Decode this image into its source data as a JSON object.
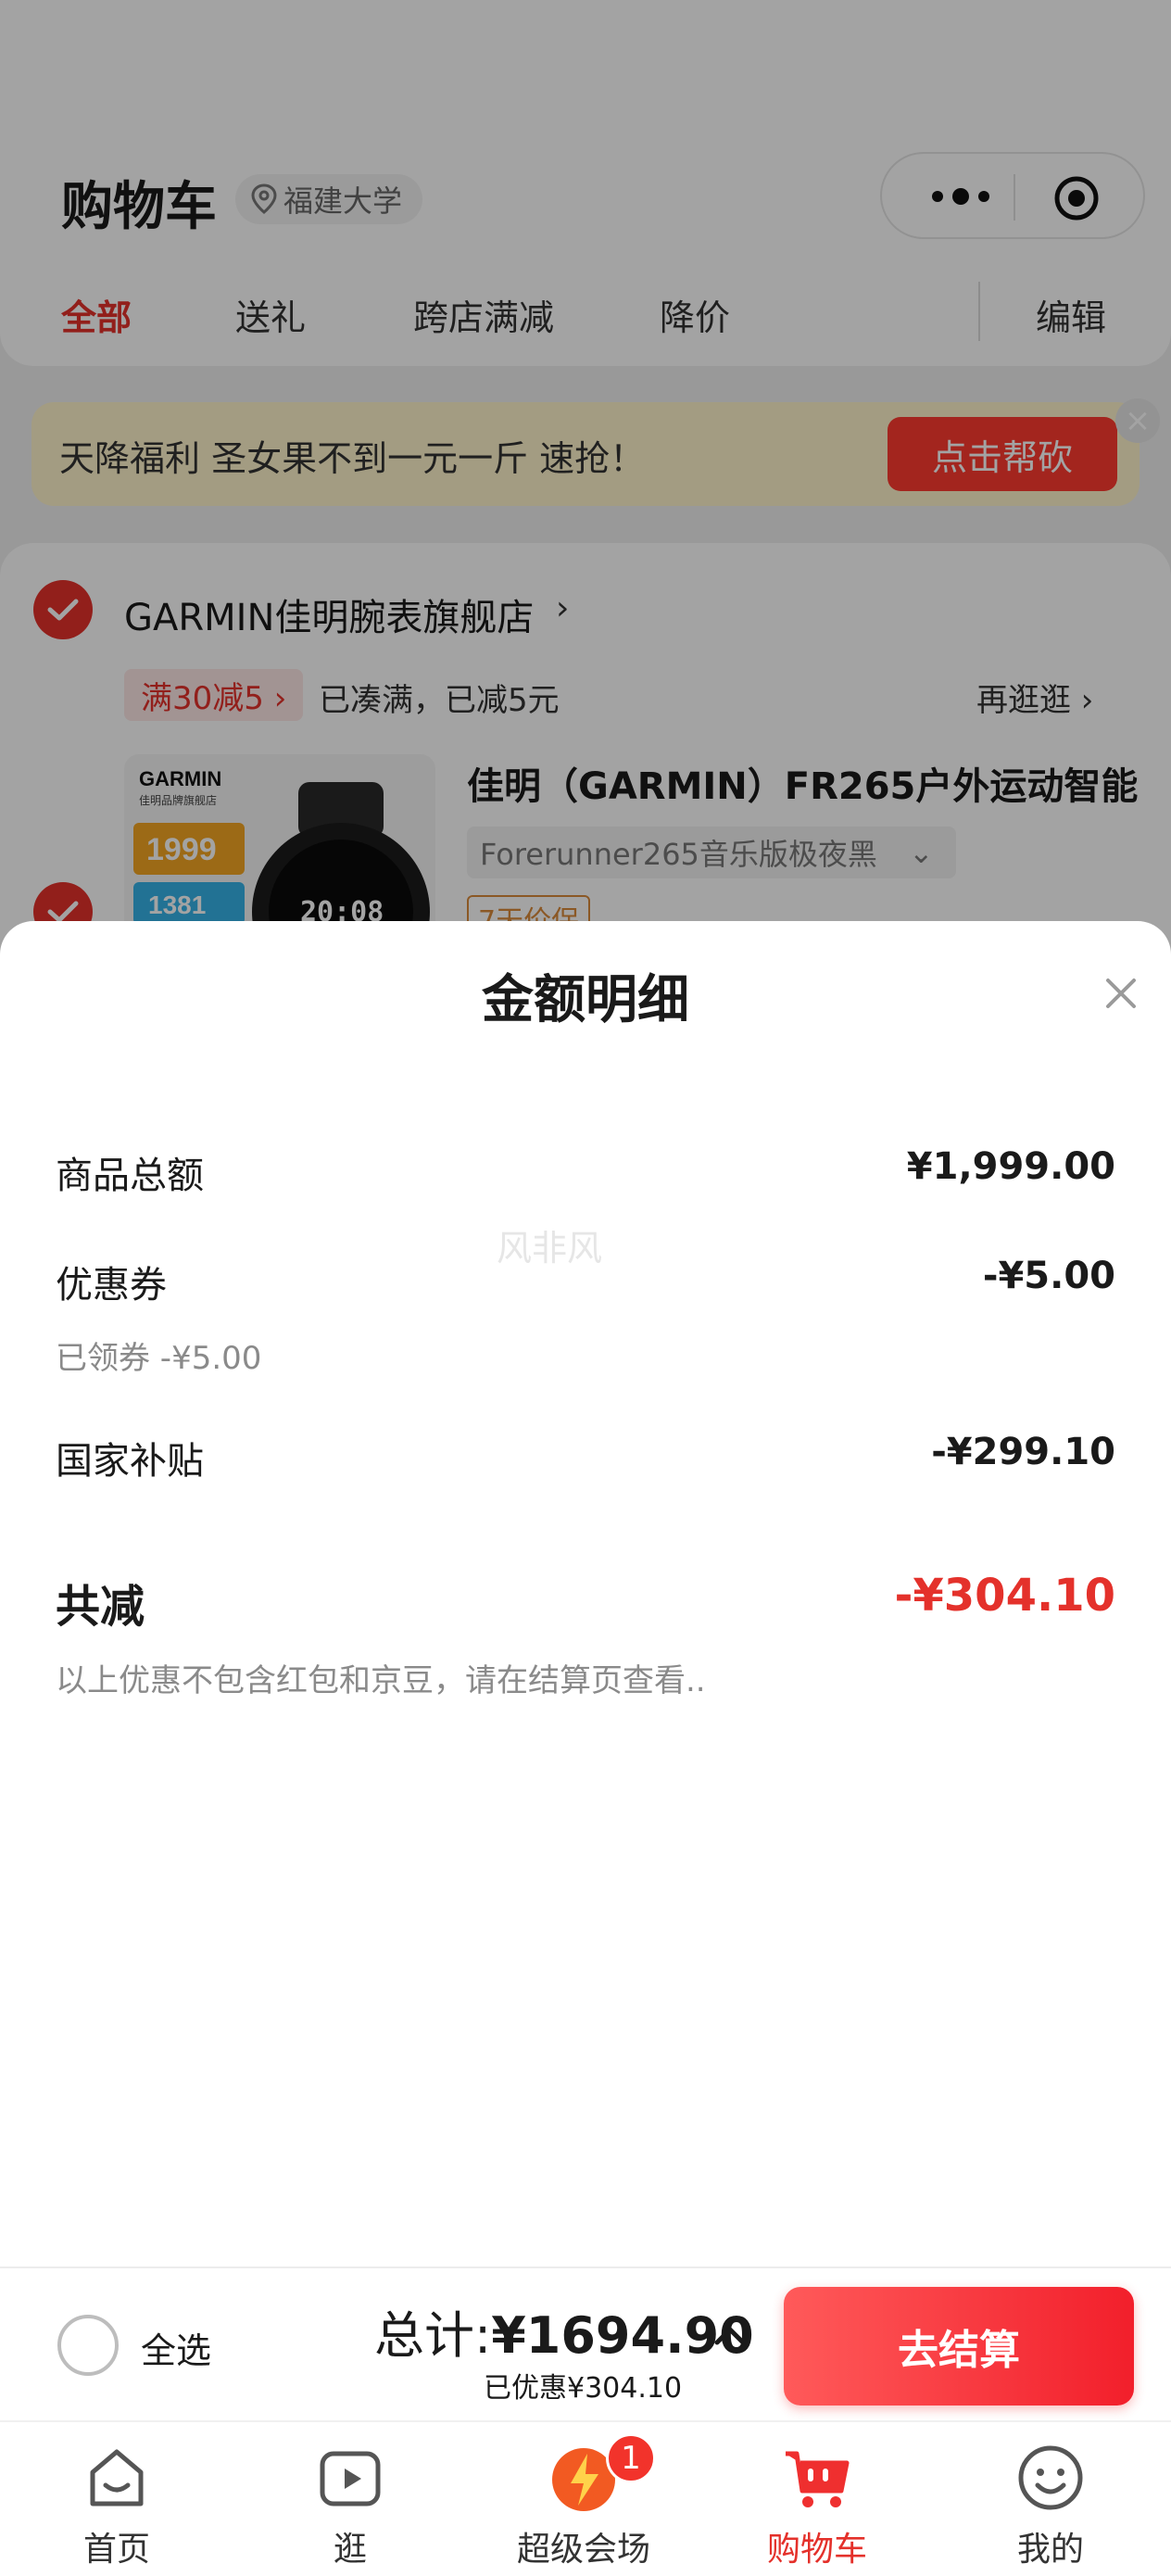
{
  "header": {
    "title": "购物车",
    "location": "福建大学",
    "tabs": [
      "全部",
      "送礼",
      "跨店满减",
      "降价"
    ],
    "edit_label": "编辑"
  },
  "promo": {
    "text": "天降福利 圣女果不到一元一斤 速抢！",
    "button": "点击帮砍",
    "close": "×"
  },
  "store": {
    "name": "GARMIN佳明腕表旗舰店",
    "chevron": "›",
    "tag": "满30减5 ›",
    "tag_note": "已凑满，已减5元",
    "more_shop": "再逛逛 ›",
    "product": {
      "title": "佳明（GARMIN）FR265户外运动智能",
      "variant": "Forerunner265音乐版极夜黑",
      "variant_chev": "⌄",
      "guarantee": "7天价保",
      "image_brand": "GARMIN",
      "image_sub": "佳明品牌旗舰店",
      "image_price1": "1999",
      "image_price2": "1381",
      "image_screen": "20:08"
    }
  },
  "sheet": {
    "title": "金额明细",
    "watermark": "风非风",
    "rows": [
      {
        "label": "商品总额",
        "value": "¥1,999.00"
      },
      {
        "label": "优惠券",
        "value": "-¥5.00",
        "sub": "已领券 -¥5.00"
      },
      {
        "label": "国家补贴",
        "value": "-¥299.10"
      }
    ],
    "total_label": "共减",
    "total_value": "-¥304.10",
    "note": "以上优惠不包含红包和京豆，请在结算页查看.."
  },
  "checkout": {
    "select_all": "全选",
    "total_prefix": "总计:",
    "total_amount": "¥1694.90",
    "saved": "已优惠¥304.10",
    "pay_button": "去结算"
  },
  "nav": {
    "items": [
      {
        "label": "首页"
      },
      {
        "label": "逛"
      },
      {
        "label": "超级会场",
        "badge": "1"
      },
      {
        "label": "购物车"
      },
      {
        "label": "我的"
      }
    ]
  },
  "colors": {
    "accent_red": "#e4312b",
    "promo_bg": "#fff5cc"
  }
}
